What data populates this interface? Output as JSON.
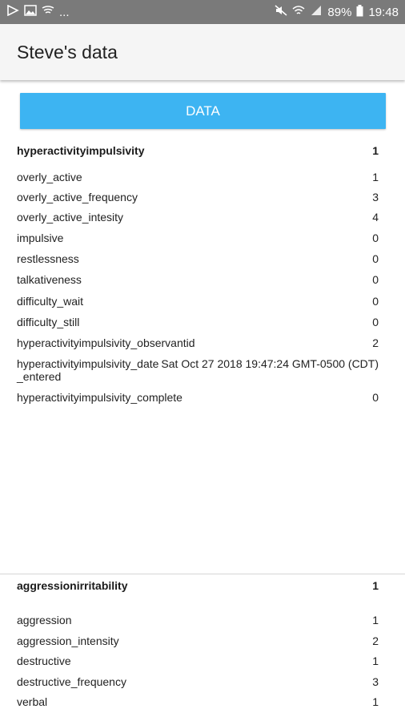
{
  "status_bar": {
    "left_more": "...",
    "battery": "89%",
    "time": "19:48"
  },
  "app_bar": {
    "title": "Steve's data"
  },
  "data_button": {
    "label": "DATA"
  },
  "sections": [
    {
      "title": "hyperactivityimpulsivity",
      "value": "1",
      "rows": [
        {
          "key": "overly_active",
          "value": "1"
        },
        {
          "key": "overly_active_frequency",
          "value": "3"
        },
        {
          "key": "overly_active_intesity",
          "value": "4"
        },
        {
          "key": "impulsive",
          "value": "0"
        },
        {
          "key": "restlessness",
          "value": "0"
        },
        {
          "key": "talkativeness",
          "value": "0"
        },
        {
          "key": "difficulty_wait",
          "value": "0"
        },
        {
          "key": "difficulty_still",
          "value": "0"
        },
        {
          "key": "hyperactivityimpulsivity_observantid",
          "value": "2"
        },
        {
          "key": "hyperactivityimpulsivity_date_entered",
          "value": "Sat Oct 27 2018 19:47:24 GMT-0500 (CDT)"
        },
        {
          "key": "hyperactivityimpulsivity_complete",
          "value": "0"
        }
      ]
    },
    {
      "title": "aggressionirritability",
      "value": "1",
      "rows": [
        {
          "key": "aggression",
          "value": "1"
        },
        {
          "key": "aggression_intensity",
          "value": "2"
        },
        {
          "key": "destructive",
          "value": "1"
        },
        {
          "key": "destructive_frequency",
          "value": "3"
        },
        {
          "key": "verbal",
          "value": "1"
        }
      ]
    }
  ]
}
